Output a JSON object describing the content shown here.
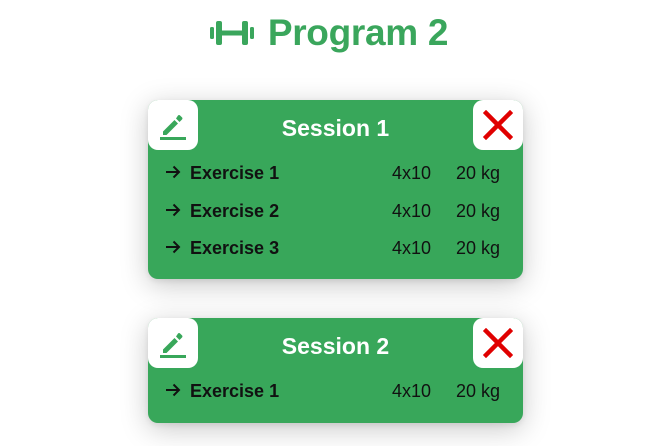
{
  "header": {
    "title": "Program 2",
    "icon": "dumbbell-icon",
    "accent_color": "#3aa65c"
  },
  "colors": {
    "card_background": "#38a75a",
    "edit_icon": "#38a75a",
    "delete_icon": "#e00000"
  },
  "sessions": [
    {
      "title": "Session 1",
      "edit_icon": "pencil-icon",
      "delete_icon": "close-icon",
      "exercises": [
        {
          "name": "Exercise 1",
          "sets": "4x10",
          "weight": "20 kg"
        },
        {
          "name": "Exercise 2",
          "sets": "4x10",
          "weight": "20 kg"
        },
        {
          "name": "Exercise 3",
          "sets": "4x10",
          "weight": "20 kg"
        }
      ]
    },
    {
      "title": "Session 2",
      "edit_icon": "pencil-icon",
      "delete_icon": "close-icon",
      "exercises": [
        {
          "name": "Exercise 1",
          "sets": "4x10",
          "weight": "20 kg"
        }
      ]
    }
  ]
}
